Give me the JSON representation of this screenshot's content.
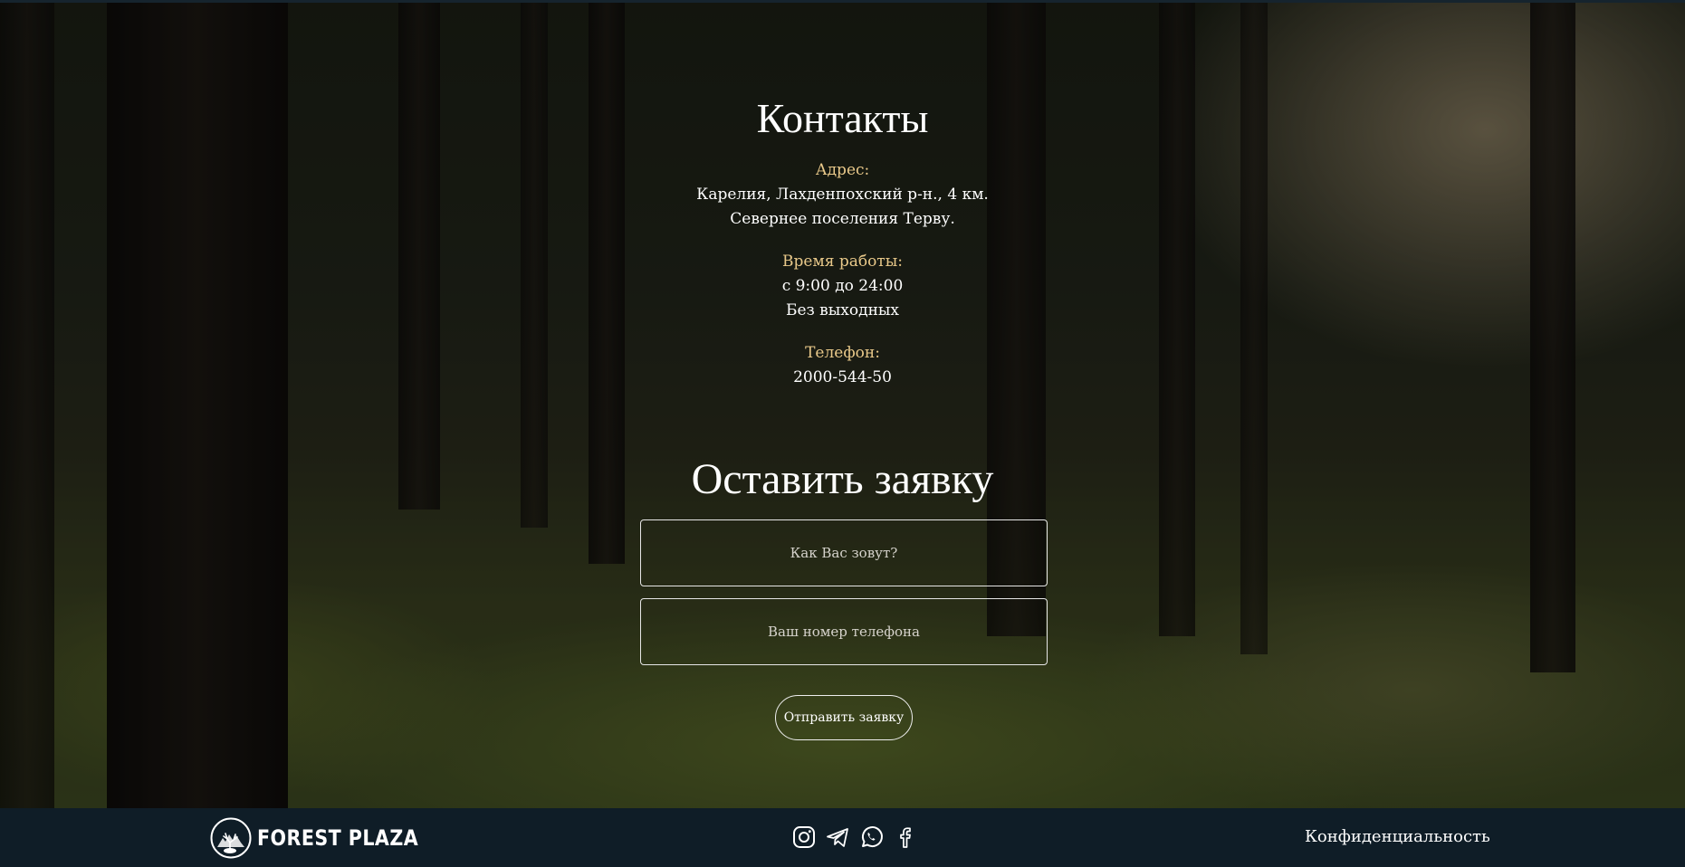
{
  "contacts": {
    "title": "Контакты",
    "address_label": "Адрес:",
    "address_line1": "Карелия, Лахденпохский р-н., 4 км.",
    "address_line2": "Севернее поселения Терву.",
    "hours_label": "Время работы:",
    "hours_line1": "с 9:00 до 24:00",
    "hours_line2": "Без выходных",
    "phone_label": "Телефон:",
    "phone_value": "2000-544-50"
  },
  "form": {
    "title": "Оставить заявку",
    "name_placeholder": "Как Вас зовут?",
    "phone_placeholder": "Ваш номер телефона",
    "submit_label": "Отправить заявку"
  },
  "footer": {
    "logo_text": "FOREST PLAZA",
    "socials": [
      "instagram-icon",
      "telegram-icon",
      "whatsapp-icon",
      "facebook-icon"
    ],
    "privacy_label": "Конфиденциальность"
  },
  "colors": {
    "label_accent": "#e9c98a",
    "footer_bg": "#0f1d27",
    "text": "#ffffff"
  }
}
